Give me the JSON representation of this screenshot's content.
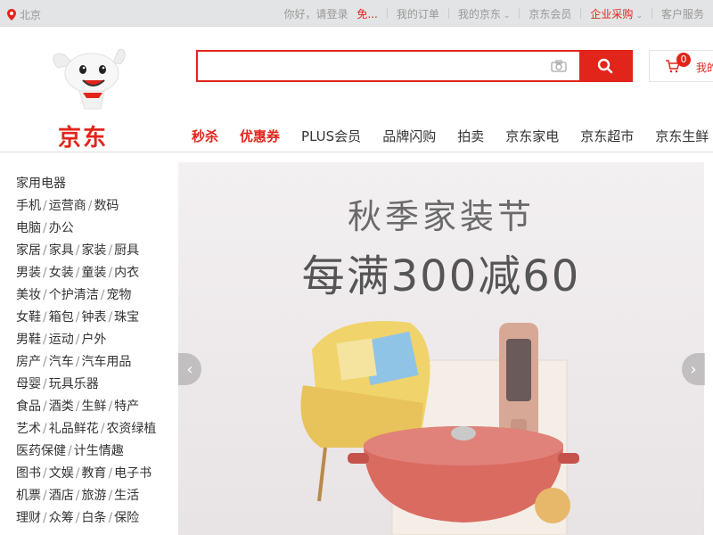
{
  "topbar": {
    "location": "北京",
    "greeting": "你好，请登录",
    "register": "免...",
    "links": [
      "我的订单",
      "我的京东",
      "京东会员",
      "企业采购",
      "客户服务"
    ]
  },
  "logo": {
    "text": "京东"
  },
  "search": {
    "placeholder": "",
    "camera_icon": "camera-icon",
    "search_icon": "search-icon"
  },
  "cart": {
    "count": "0",
    "label": "我的"
  },
  "nav": [
    "秒杀",
    "优惠券",
    "PLUS会员",
    "品牌闪购",
    "拍卖",
    "京东家电",
    "京东超市",
    "京东生鲜"
  ],
  "categories": [
    [
      "家用电器"
    ],
    [
      "手机",
      "运营商",
      "数码"
    ],
    [
      "电脑",
      "办公"
    ],
    [
      "家居",
      "家具",
      "家装",
      "厨具"
    ],
    [
      "男装",
      "女装",
      "童装",
      "内衣"
    ],
    [
      "美妆",
      "个护清洁",
      "宠物"
    ],
    [
      "女鞋",
      "箱包",
      "钟表",
      "珠宝"
    ],
    [
      "男鞋",
      "运动",
      "户外"
    ],
    [
      "房产",
      "汽车",
      "汽车用品"
    ],
    [
      "母婴",
      "玩具乐器"
    ],
    [
      "食品",
      "酒类",
      "生鲜",
      "特产"
    ],
    [
      "艺术",
      "礼品鲜花",
      "农资绿植"
    ],
    [
      "医药保健",
      "计生情趣"
    ],
    [
      "图书",
      "文娱",
      "教育",
      "电子书"
    ],
    [
      "机票",
      "酒店",
      "旅游",
      "生活"
    ],
    [
      "理财",
      "众筹",
      "白条",
      "保险"
    ]
  ],
  "banner": {
    "title_line1": "秋季家装节",
    "title_line2": "每满300减60"
  },
  "colors": {
    "brand_red": "#e1251b"
  }
}
